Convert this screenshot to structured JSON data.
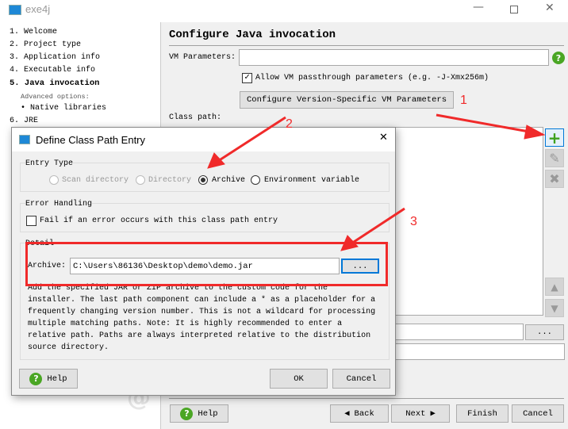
{
  "window": {
    "title": "exe4j"
  },
  "sidebar": {
    "items": [
      {
        "label": "1. Welcome",
        "bold": false
      },
      {
        "label": "2. Project type",
        "bold": false
      },
      {
        "label": "3. Application info",
        "bold": false
      },
      {
        "label": "4. Executable info",
        "bold": false
      },
      {
        "label": "5. Java invocation",
        "bold": true
      },
      {
        "label": "Advanced options:",
        "bold": false
      },
      {
        "label": "• Native libraries",
        "bold": false
      },
      {
        "label": "6. JRE",
        "bold": false
      }
    ]
  },
  "main": {
    "title": "Configure Java invocation",
    "vm_label": "VM Parameters:",
    "vm_value": "",
    "allow_passthrough": "Allow VM passthrough parameters (e.g. -J-Xmx256m)",
    "allow_checked": true,
    "configure_button": "Configure Version-Specific VM Parameters",
    "classpath_label": "Class path:",
    "browse_label": "...",
    "help": "Help",
    "back": "Back",
    "next": "Next",
    "finish": "Finish",
    "cancel": "Cancel"
  },
  "annotations": {
    "one": "1",
    "two": "2",
    "three": "3",
    "color": "#f02a2a"
  },
  "dialog": {
    "title": "Define Class Path Entry",
    "entry_type_label": "Entry Type",
    "options": [
      "Scan directory",
      "Directory",
      "Archive",
      "Environment variable"
    ],
    "selected": "Archive",
    "error_label": "Error Handling",
    "fail_label": "Fail if an error occurs with this class path entry",
    "fail_checked": false,
    "detail_label": "Detail",
    "archive_label": "Archive:",
    "archive_value": "C:\\Users\\86136\\Desktop\\demo\\demo.jar",
    "browse_label": "...",
    "description": [
      "Add the specified JAR or ZIP archive to the custom code for the",
      "installer. The last path component can include a * as a placeholder for a",
      "frequently changing version number. This is not a wildcard for processing",
      "multiple matching paths. Note: It is highly recommended to enter a",
      "relative path. Paths are always interpreted relative to the distribution",
      "source directory."
    ],
    "help": "Help",
    "ok": "OK",
    "cancel": "Cancel"
  }
}
